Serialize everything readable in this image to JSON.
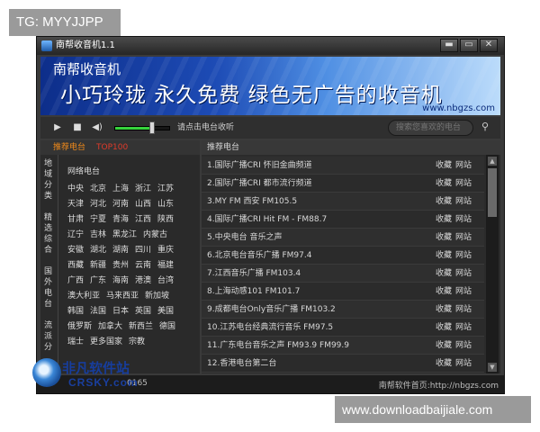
{
  "watermarks": {
    "top": "TG: MYYJJPP",
    "bottom": "www.downloadbaijiale.com"
  },
  "window": {
    "title": "南帮收音机1.1",
    "controls": [
      "▬",
      "▭",
      "✕"
    ]
  },
  "banner": {
    "brand": "南帮收音机",
    "slogan": "小巧玲珑 永久免费 绿色无广告的收音机",
    "url": "www.nbgzs.com"
  },
  "player": {
    "play_icon": "play-icon",
    "stop_icon": "stop-icon",
    "speaker_icon": "speaker-icon",
    "volume_level": 0.64,
    "hint": "请点击电台收听",
    "search_placeholder": "搜索您喜欢的电台"
  },
  "left_panel": {
    "tabs": [
      "推荐电台",
      "TOP100"
    ],
    "categories": [
      "地域分类",
      "精选综合",
      "国外电台",
      "流派分"
    ],
    "region_title": "网络电台",
    "regions": [
      [
        "中央",
        "北京",
        "上海",
        "浙江",
        "江苏"
      ],
      [
        "天津",
        "河北",
        "河南",
        "山西",
        "山东"
      ],
      [
        "甘肃",
        "宁夏",
        "青海",
        "江西",
        "陕西"
      ],
      [
        "辽宁",
        "吉林",
        "黑龙江",
        "内蒙古"
      ],
      [
        "安徽",
        "湖北",
        "湖南",
        "四川",
        "重庆"
      ],
      [
        "西藏",
        "新疆",
        "贵州",
        "云南",
        "福建"
      ],
      [
        "广西",
        "广东",
        "海南",
        "港澳",
        "台湾"
      ],
      [
        "澳大利亚",
        "马来西亚",
        "新加坡"
      ],
      [
        "韩国",
        "法国",
        "日本",
        "英国",
        "美国"
      ],
      [
        "俄罗斯",
        "加拿大",
        "新西兰",
        "德国"
      ],
      [
        "瑞士",
        "更多国家",
        "宗教"
      ]
    ]
  },
  "right_panel": {
    "header": "推荐电台",
    "fav_label": "收藏",
    "site_label": "网站",
    "stations": [
      "1.国际广播CRI 怀旧金曲频道",
      "2.国际广播CRI 都市流行频道",
      "3.MY FM 西安 FM105.5",
      "4.国际广播CRI Hit FM - FM88.7",
      "5.中央电台 音乐之声",
      "6.北京电台音乐广播 FM97.4",
      "7.江西音乐广播 FM103.4",
      "8.上海动感101 FM101.7",
      "9.成都电台Only音乐广播 FM103.2",
      "10.江苏电台经典流行音乐 FM97.5",
      "11.广东电台音乐之声 FM93.9 FM99.9",
      "12.香港电台第二台"
    ]
  },
  "status": {
    "count": "0165",
    "home": "南帮软件首页:http://nbgzs.com"
  },
  "site_logo": {
    "cn": "非凡软件站",
    "en": "CRSKY.com"
  }
}
